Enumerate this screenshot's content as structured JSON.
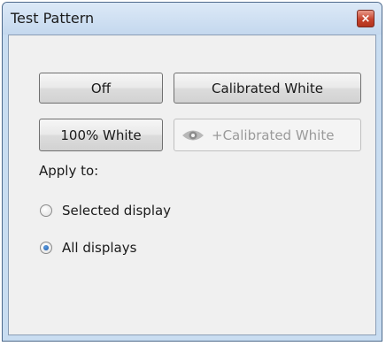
{
  "window": {
    "title": "Test Pattern",
    "close_glyph": "×"
  },
  "buttons": {
    "off": "Off",
    "calibrated_white": "Calibrated White",
    "white_100": "100% White",
    "plus_calibrated_white": "+Calibrated White"
  },
  "apply": {
    "label": "Apply to:",
    "options": [
      {
        "label": "Selected display",
        "selected": false
      },
      {
        "label": "All displays",
        "selected": true
      }
    ]
  },
  "icons": {
    "close": "close-icon",
    "eye": "eye-icon"
  },
  "colors": {
    "frame": "#c9ddf1",
    "client": "#f0f0f0",
    "close_button": "#c6432d",
    "radio_selected": "#1e5aa8",
    "disabled_text": "#9a9a9a"
  }
}
